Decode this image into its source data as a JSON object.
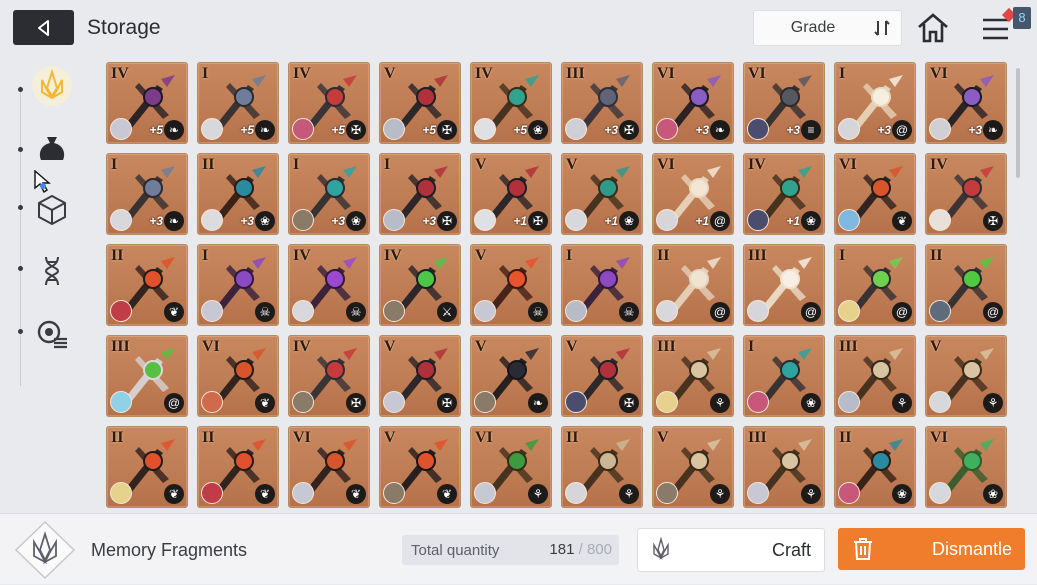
{
  "header": {
    "title": "Storage",
    "sort_label": "Grade",
    "notification_count": "8"
  },
  "sidebar": {
    "categories": [
      {
        "icon": "memory-fragment-icon",
        "active": true
      },
      {
        "icon": "pouch-icon",
        "active": false
      },
      {
        "icon": "cube-icon",
        "active": false
      },
      {
        "icon": "dna-icon",
        "active": false
      },
      {
        "icon": "shield-list-icon",
        "active": false
      }
    ]
  },
  "items": [
    {
      "grade": "IV",
      "level": "+5",
      "type": "light",
      "art": "chain",
      "char": "#c8c8d4"
    },
    {
      "grade": "I",
      "level": "+5",
      "type": "light",
      "art": "cross",
      "char": "#d8d8dc"
    },
    {
      "grade": "IV",
      "level": "+5",
      "type": "fort",
      "art": "mace",
      "char": "#c45a7a"
    },
    {
      "grade": "V",
      "level": "+5",
      "type": "fort",
      "art": "claw",
      "char": "#b8bcc8"
    },
    {
      "grade": "IV",
      "level": "+5",
      "type": "paw",
      "art": "necklace",
      "char": "#dfe0e4"
    },
    {
      "grade": "III",
      "level": "+3",
      "type": "fort",
      "art": "morningstar",
      "char": "#cfd0d6"
    },
    {
      "grade": "VI",
      "level": "+3",
      "type": "light",
      "art": "feather",
      "char": "#c8587a"
    },
    {
      "grade": "VI",
      "level": "+3",
      "type": "claw",
      "art": "wing",
      "char": "#4b4d6e"
    },
    {
      "grade": "I",
      "level": "+3",
      "type": "swirl",
      "art": "staff",
      "char": "#d6d6da"
    },
    {
      "grade": "VI",
      "level": "+3",
      "type": "light",
      "art": "feather",
      "char": "#d0d0d4"
    },
    {
      "grade": "I",
      "level": "+3",
      "type": "light",
      "art": "cross",
      "char": "#d8d8dc"
    },
    {
      "grade": "II",
      "level": "+3",
      "type": "paw",
      "art": "flower",
      "char": "#dcdcde"
    },
    {
      "grade": "I",
      "level": "+3",
      "type": "paw",
      "art": "orbstaff",
      "char": "#8a7a68"
    },
    {
      "grade": "I",
      "level": "+3",
      "type": "fort",
      "art": "claw",
      "char": "#b8bcc8"
    },
    {
      "grade": "V",
      "level": "+1",
      "type": "fort",
      "art": "claw",
      "char": "#dfe0e4"
    },
    {
      "grade": "V",
      "level": "+1",
      "type": "paw",
      "art": "chalice",
      "char": "#d7d8dc"
    },
    {
      "grade": "VI",
      "level": "+1",
      "type": "swirl",
      "art": "wing-light",
      "char": "#d6d6da"
    },
    {
      "grade": "IV",
      "level": "+1",
      "type": "paw",
      "art": "necklace",
      "char": "#4b4d6e"
    },
    {
      "grade": "VI",
      "level": "",
      "type": "flame",
      "art": "feather-red",
      "char": "#7fb8e0"
    },
    {
      "grade": "IV",
      "level": "",
      "type": "fort",
      "art": "mace",
      "char": "#e9e0d8"
    },
    {
      "grade": "II",
      "level": "",
      "type": "flame",
      "art": "wand",
      "char": "#c03c46"
    },
    {
      "grade": "I",
      "level": "",
      "type": "skull",
      "art": "scythe",
      "char": "#c8c8d4"
    },
    {
      "grade": "IV",
      "level": "",
      "type": "skull",
      "art": "chain-purple",
      "char": "#d8d8dc"
    },
    {
      "grade": "IV",
      "level": "",
      "type": "sword",
      "art": "gear",
      "char": "#8a7a68"
    },
    {
      "grade": "V",
      "level": "",
      "type": "skull",
      "art": "lantern",
      "char": "#c8c8d4"
    },
    {
      "grade": "I",
      "level": "",
      "type": "skull",
      "art": "scythe",
      "char": "#b8bcc8"
    },
    {
      "grade": "II",
      "level": "",
      "type": "swirl",
      "art": "staff-light",
      "char": "#d7d8dc"
    },
    {
      "grade": "III",
      "level": "",
      "type": "swirl",
      "art": "ribbon",
      "char": "#d6d6da"
    },
    {
      "grade": "I",
      "level": "",
      "type": "swirl",
      "art": "sword-green",
      "char": "#e6d28c"
    },
    {
      "grade": "II",
      "level": "",
      "type": "swirl",
      "art": "syringe",
      "char": "#5f6a7a"
    },
    {
      "grade": "III",
      "level": "",
      "type": "swirl",
      "art": "potion",
      "char": "#8fd2e8"
    },
    {
      "grade": "VI",
      "level": "",
      "type": "flame",
      "art": "feather-red",
      "char": "#d06a4a"
    },
    {
      "grade": "IV",
      "level": "",
      "type": "fort",
      "art": "mace",
      "char": "#8a7a68"
    },
    {
      "grade": "V",
      "level": "",
      "type": "fort",
      "art": "claw",
      "char": "#c8c8d4"
    },
    {
      "grade": "V",
      "level": "",
      "type": "light",
      "art": "raven",
      "char": "#8a7a68"
    },
    {
      "grade": "V",
      "level": "",
      "type": "fort",
      "art": "claw",
      "char": "#4b4d6e"
    },
    {
      "grade": "III",
      "level": "",
      "type": "sprout",
      "art": "skulls",
      "char": "#e6d28c"
    },
    {
      "grade": "I",
      "level": "",
      "type": "paw",
      "art": "orbstaff",
      "char": "#c8587a"
    },
    {
      "grade": "III",
      "level": "",
      "type": "sprout",
      "art": "skulls",
      "char": "#b8bcc8"
    },
    {
      "grade": "V",
      "level": "",
      "type": "sprout",
      "art": "skulls",
      "char": "#d7d8dc"
    },
    {
      "grade": "II",
      "level": "",
      "type": "flame",
      "art": "wand",
      "char": "#e6d28c"
    },
    {
      "grade": "II",
      "level": "",
      "type": "flame",
      "art": "wand",
      "char": "#c03c46"
    },
    {
      "grade": "VI",
      "level": "",
      "type": "flame",
      "art": "feather-red",
      "char": "#c8c8d4"
    },
    {
      "grade": "V",
      "level": "",
      "type": "flame",
      "art": "chalice-dark",
      "char": "#8a7a68"
    },
    {
      "grade": "VI",
      "level": "",
      "type": "sprout",
      "art": "branch",
      "char": "#c8c8d4"
    },
    {
      "grade": "II",
      "level": "",
      "type": "sprout",
      "art": "totem",
      "char": "#d6d6da"
    },
    {
      "grade": "V",
      "level": "",
      "type": "sprout",
      "art": "skulls",
      "char": "#8a7a68"
    },
    {
      "grade": "III",
      "level": "",
      "type": "sprout",
      "art": "skulls",
      "char": "#c8c8d4"
    },
    {
      "grade": "II",
      "level": "",
      "type": "paw",
      "art": "flower",
      "char": "#c8587a"
    },
    {
      "grade": "VI",
      "level": "",
      "type": "paw",
      "art": "leaf",
      "char": "#d7d8dc"
    }
  ],
  "footer": {
    "fragment_label": "Memory Fragments",
    "total_label": "Total quantity",
    "total_value": "181",
    "total_max": "800",
    "craft_label": "Craft",
    "dismantle_label": "Dismantle"
  }
}
